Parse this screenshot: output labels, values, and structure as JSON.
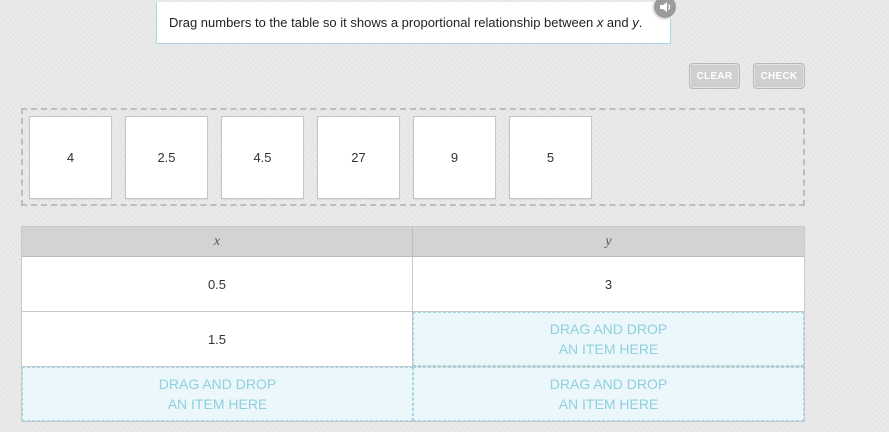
{
  "prompt": {
    "text_before": "Drag numbers to the table so it shows a proportional relationship between ",
    "var_x": "x",
    "text_mid": " and ",
    "var_y": "y",
    "text_after": "."
  },
  "controls": {
    "audio_icon": "speaker-icon",
    "clear_label": "CLEAR",
    "check_label": "CHECK"
  },
  "tiles": [
    "4",
    "2.5",
    "4.5",
    "27",
    "9",
    "5"
  ],
  "table": {
    "headers": [
      "x",
      "y"
    ],
    "rows": [
      {
        "x": "0.5",
        "y": "3"
      },
      {
        "x": "1.5"
      },
      {}
    ],
    "drop_line1": "DRAG AND DROP",
    "drop_line2": "AN ITEM HERE"
  },
  "colors": {
    "drop_text": "#8fd0de",
    "drop_bg": "#ebf7fa",
    "prompt_border": "#a9d7e2"
  }
}
